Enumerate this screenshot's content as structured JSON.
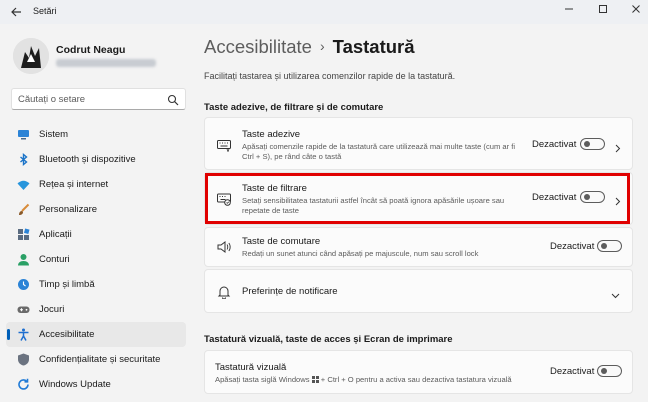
{
  "window": {
    "title": "Setări",
    "back_icon": "arrow-left-icon"
  },
  "profile": {
    "name": "Codrut Neagu"
  },
  "search": {
    "placeholder": "Căutați o setare"
  },
  "nav": {
    "items": [
      {
        "label": "Sistem",
        "icon": "monitor-icon",
        "color": "#2b83d6"
      },
      {
        "label": "Bluetooth și dispozitive",
        "icon": "bluetooth-icon",
        "color": "#1a73c8"
      },
      {
        "label": "Rețea și internet",
        "icon": "wifi-icon",
        "color": "#2795dc"
      },
      {
        "label": "Personalizare",
        "icon": "brush-icon",
        "color": "#d88b3a"
      },
      {
        "label": "Aplicații",
        "icon": "apps-icon",
        "color": "#5a6b80"
      },
      {
        "label": "Conturi",
        "icon": "person-icon",
        "color": "#2aa065"
      },
      {
        "label": "Timp și limbă",
        "icon": "globe-clock-icon",
        "color": "#2b83d6"
      },
      {
        "label": "Jocuri",
        "icon": "gamepad-icon",
        "color": "#6a6a6a"
      },
      {
        "label": "Accesibilitate",
        "icon": "accessibility-icon",
        "color": "#1e6fd0",
        "active": true
      },
      {
        "label": "Confidențialitate și securitate",
        "icon": "shield-icon",
        "color": "#6b7380"
      },
      {
        "label": "Windows Update",
        "icon": "update-icon",
        "color": "#1f7ad6"
      }
    ]
  },
  "header": {
    "parent": "Accesibilitate",
    "separator": "›",
    "current": "Tastatură",
    "intro": "Facilitați tastarea și utilizarea comenzilor rapide de la tastatură."
  },
  "section1": {
    "title": "Taste adezive, de filtrare și de comutare",
    "cards": [
      {
        "title": "Taste adezive",
        "desc1": "Apăsați comenzile rapide de la tastatură care utilizează mai multe taste (cum ar fi",
        "desc2": "Ctrl + S), pe rând câte o tastă",
        "status": "Dezactivat"
      },
      {
        "title": "Taste de filtrare",
        "desc1": "Setați sensibilitatea tastaturii astfel încât să poată ignora apăsările ușoare sau",
        "desc2": "repetate de taste",
        "status": "Dezactivat"
      },
      {
        "title": "Taste de comutare",
        "desc1": "Redați un sunet atunci când apăsați pe majuscule, num sau scroll lock",
        "status": "Dezactivat"
      }
    ],
    "notifications": {
      "title": "Preferințe de notificare"
    }
  },
  "section2": {
    "title": "Tastatură vizuală, taste de acces și Ecran de imprimare",
    "cards": [
      {
        "title": "Tastatură vizuală",
        "desc1": "Apăsați tasta siglă Windows",
        "desc2": "+ Ctrl + O pentru a activa sau dezactiva tastatura vizuală",
        "status": "Dezactivat"
      }
    ]
  },
  "colors": {
    "accent": "#005fb8",
    "highlight": "#e00000"
  }
}
